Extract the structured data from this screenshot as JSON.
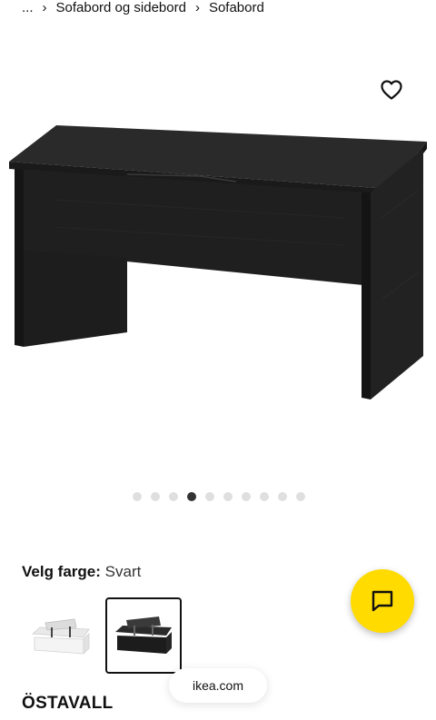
{
  "breadcrumb": {
    "ellipsis": "...",
    "sep": "›",
    "items": [
      {
        "label": "Sofabord og sidebord"
      },
      {
        "label": "Sofabord"
      }
    ]
  },
  "carousel": {
    "count": 10,
    "active_index": 3
  },
  "color_picker": {
    "label": "Velg farge:",
    "selected": "Svart",
    "options": [
      {
        "name": "white",
        "color": "#f2f2f2"
      },
      {
        "name": "black",
        "color": "#1c1c1c"
      }
    ]
  },
  "product": {
    "name": "ÖSTAVALL"
  },
  "browser": {
    "url": "ikea.com"
  },
  "colors": {
    "accent_yellow": "#ffdb00",
    "dot_inactive": "#dfdfdf",
    "dot_active": "#333333",
    "table_color": "#222222"
  },
  "icons": {
    "favourite": "heart-icon",
    "chat": "chat-bubble-icon"
  }
}
